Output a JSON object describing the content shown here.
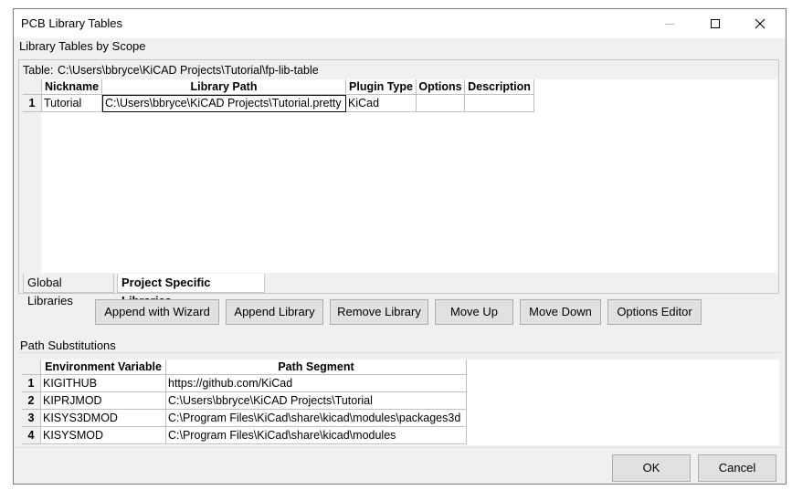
{
  "window": {
    "title": "PCB Library Tables"
  },
  "scope_section": {
    "heading": "Library Tables by Scope",
    "table_path_label": "Table:",
    "table_path_value": "C:\\Users\\bbryce\\KiCAD Projects\\Tutorial\\fp-lib-table",
    "columns": [
      "Nickname",
      "Library Path",
      "Plugin Type",
      "Options",
      "Description"
    ],
    "rows": [
      {
        "num": "1",
        "nickname": "Tutorial",
        "path": "C:\\Users\\bbryce\\KiCAD Projects\\Tutorial.pretty",
        "plugin": "KiCad",
        "options": "",
        "description": ""
      }
    ],
    "tabs": [
      "Global Libraries",
      "Project Specific Libraries"
    ],
    "active_tab": "Project Specific Libraries"
  },
  "buttons": {
    "append_wizard": "Append with Wizard",
    "append_library": "Append Library",
    "remove_library": "Remove Library",
    "move_up": "Move Up",
    "move_down": "Move Down",
    "options_editor": "Options Editor"
  },
  "path_section": {
    "heading": "Path Substitutions",
    "columns": [
      "Environment Variable",
      "Path Segment"
    ],
    "rows": [
      {
        "num": "1",
        "var": "KIGITHUB",
        "path": "https://github.com/KiCad"
      },
      {
        "num": "2",
        "var": "KIPRJMOD",
        "path": "C:\\Users\\bbryce\\KiCAD Projects\\Tutorial"
      },
      {
        "num": "3",
        "var": "KISYS3DMOD",
        "path": "C:\\Program Files\\KiCad\\share\\kicad\\modules\\packages3d"
      },
      {
        "num": "4",
        "var": "KISYSMOD",
        "path": "C:\\Program Files\\KiCad\\share\\kicad\\modules"
      }
    ]
  },
  "footer": {
    "ok": "OK",
    "cancel": "Cancel"
  }
}
